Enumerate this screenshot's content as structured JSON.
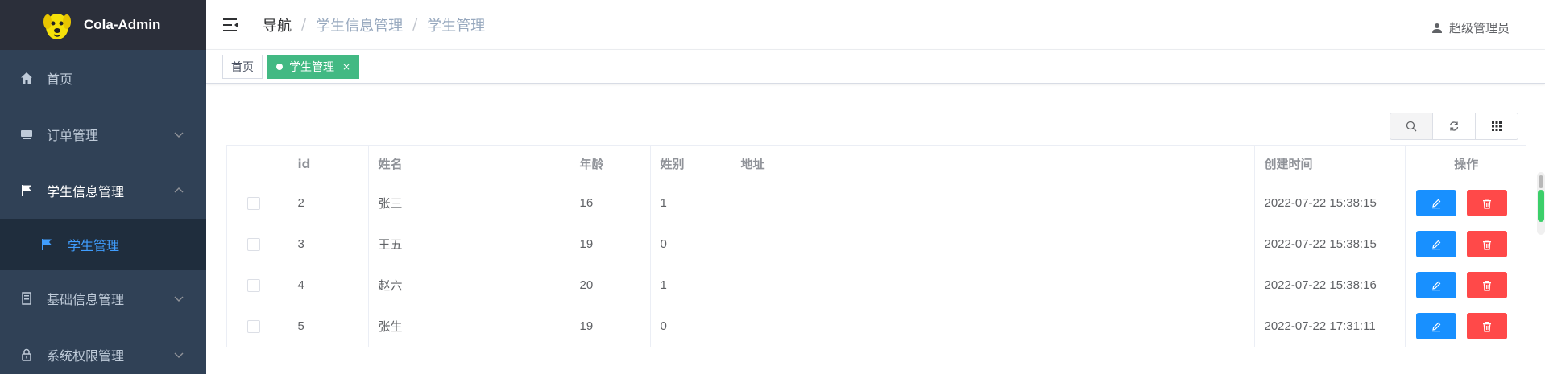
{
  "app": {
    "title": "Cola-Admin"
  },
  "sidebar": {
    "items": [
      {
        "label": "首页",
        "icon": "home-icon"
      },
      {
        "label": "订单管理",
        "icon": "order-icon"
      },
      {
        "label": "学生信息管理",
        "icon": "flag-icon",
        "expanded": true
      },
      {
        "label": "基础信息管理",
        "icon": "building-icon"
      },
      {
        "label": "系统权限管理",
        "icon": "lock-icon"
      }
    ],
    "submenu": {
      "label": "学生管理",
      "icon": "flag-icon"
    }
  },
  "header": {
    "breadcrumb": [
      "导航",
      "学生信息管理",
      "学生管理"
    ],
    "user": "超级管理员"
  },
  "tags": [
    {
      "label": "首页",
      "active": false
    },
    {
      "label": "学生管理",
      "active": true,
      "close": "×"
    }
  ],
  "toolbar": [
    "search-icon",
    "refresh-icon",
    "columns-icon"
  ],
  "table": {
    "columns": [
      "",
      "id",
      "姓名",
      "年龄",
      "姓别",
      "地址",
      "创建时间",
      "操作"
    ],
    "rows": [
      {
        "id": "2",
        "name": "张三",
        "age": "16",
        "gender": "1",
        "address": "",
        "created": "2022-07-22 15:38:15"
      },
      {
        "id": "3",
        "name": "王五",
        "age": "19",
        "gender": "0",
        "address": "",
        "created": "2022-07-22 15:38:15"
      },
      {
        "id": "4",
        "name": "赵六",
        "age": "20",
        "gender": "1",
        "address": "",
        "created": "2022-07-22 15:38:16"
      },
      {
        "id": "5",
        "name": "张生",
        "age": "19",
        "gender": "0",
        "address": "",
        "created": "2022-07-22 17:31:11"
      }
    ]
  },
  "colors": {
    "sidebar_bg": "#304156",
    "logo_bg": "#2b2f3a",
    "submenu_bg": "#1f2d3d",
    "active_text": "#409eff",
    "tag_active": "#42b983",
    "edit_btn": "#1890ff",
    "delete_btn": "#ff4949"
  }
}
